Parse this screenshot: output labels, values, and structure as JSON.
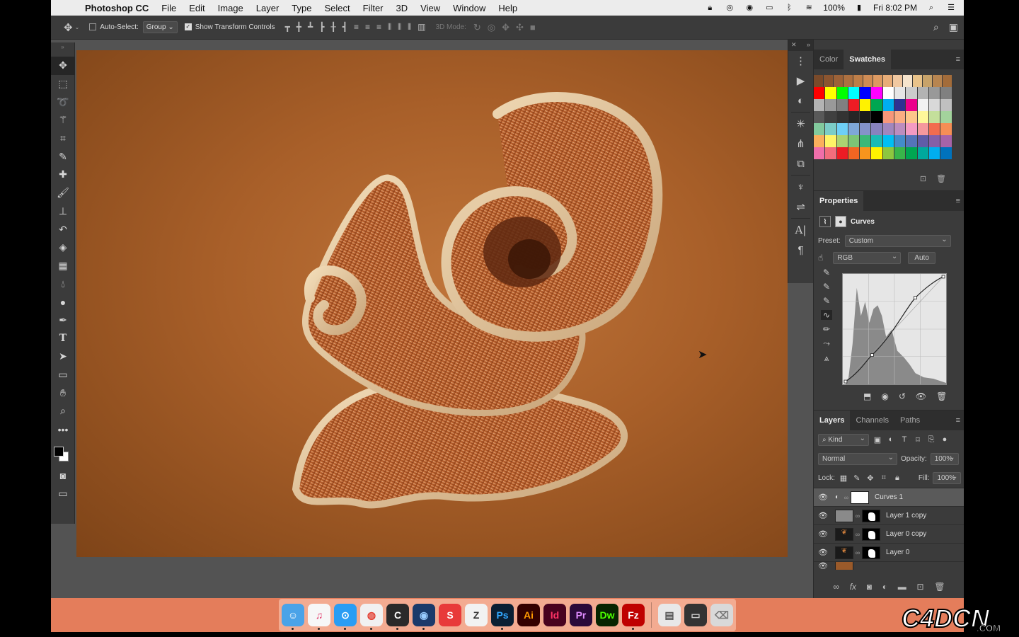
{
  "menubar": {
    "app_name": "Photoshop CC",
    "items": [
      "File",
      "Edit",
      "Image",
      "Layer",
      "Type",
      "Select",
      "Filter",
      "3D",
      "View",
      "Window",
      "Help"
    ],
    "battery": "100%",
    "clock": "Fri 8:02 PM"
  },
  "options": {
    "auto_select_label": "Auto-Select:",
    "auto_select_value": "Group",
    "show_transform_label": "Show Transform Controls",
    "mode_3d_label": "3D Mode:"
  },
  "swatches_panel": {
    "tabs": [
      "Color",
      "Swatches"
    ],
    "active_tab": "Swatches",
    "rows": [
      [
        "#7a4a2a",
        "#8b5530",
        "#9c6238",
        "#ad7040",
        "#be7e48",
        "#cf8c55",
        "#dd9a62",
        "#e8ad78",
        "#f1c8a0",
        "#f6e4cc",
        "#e9c38a",
        "#c8a36a",
        "#b88550",
        "#a36c3a"
      ],
      [
        "#ff0000",
        "#ffff00",
        "#00ff00",
        "#00ffff",
        "#0000ff",
        "#ff00ff",
        "#ffffff",
        "#e6e6e6",
        "#cccccc",
        "#b3b3b3",
        "#999999",
        "#808080"
      ],
      [
        "#b3b3b3",
        "#999999",
        "#808080",
        "#ed1c24",
        "#fff200",
        "#00a651",
        "#00aeef",
        "#2e3192",
        "#ec008c",
        "#f2f2f2",
        "#d9d9d9",
        "#c0c0c0"
      ],
      [
        "#595959",
        "#404040",
        "#333333",
        "#262626",
        "#1a1a1a",
        "#000000",
        "#f7977a",
        "#fbad82",
        "#fdc68a",
        "#fff79a",
        "#c4df9b",
        "#a3d39c"
      ],
      [
        "#82ca9d",
        "#7bcdc8",
        "#6ecff6",
        "#7ea7d8",
        "#8493ca",
        "#8882be",
        "#a187be",
        "#bc8dbf",
        "#f49ac2",
        "#f6989d",
        "#f26c4f",
        "#f68e55"
      ],
      [
        "#fbaf5c",
        "#fff467",
        "#acd372",
        "#7cc576",
        "#3bb878",
        "#1abbb4",
        "#00bff3",
        "#438cca",
        "#5574b9",
        "#605ca8",
        "#855fa8",
        "#a763a8"
      ],
      [
        "#f06eaa",
        "#f26d7d",
        "#ed1c24",
        "#f26522",
        "#f7941d",
        "#fff200",
        "#8dc73f",
        "#39b54a",
        "#00a651",
        "#00a99d",
        "#00aeef",
        "#0072bc"
      ]
    ]
  },
  "properties_panel": {
    "title": "Properties",
    "adjustment": "Curves",
    "preset_label": "Preset:",
    "preset_value": "Custom",
    "channel_value": "RGB",
    "auto_label": "Auto"
  },
  "layers_panel": {
    "tabs": [
      "Layers",
      "Channels",
      "Paths"
    ],
    "active_tab": "Layers",
    "filter_kind": "Kind",
    "blend_mode": "Normal",
    "opacity_label": "Opacity:",
    "opacity_value": "100%",
    "lock_label": "Lock:",
    "fill_label": "Fill:",
    "fill_value": "100%",
    "layers": [
      {
        "name": "Curves 1",
        "selected": true
      },
      {
        "name": "Layer 1 copy",
        "selected": false
      },
      {
        "name": "Layer 0 copy",
        "selected": false
      },
      {
        "name": "Layer 0",
        "selected": false
      }
    ]
  },
  "dock_apps": [
    {
      "label": "☺",
      "bg": "#4aa3e8",
      "fg": "#fff"
    },
    {
      "label": "♫",
      "bg": "#f7f7f7",
      "fg": "#e23a6b"
    },
    {
      "label": "⊙",
      "bg": "#2a9df4",
      "fg": "#fff"
    },
    {
      "label": "◍",
      "bg": "#f1f1f1",
      "fg": "#e33b2e"
    },
    {
      "label": "C",
      "bg": "#2a2a2a",
      "fg": "#fff"
    },
    {
      "label": "◉",
      "bg": "#1a3a6a",
      "fg": "#9cf"
    },
    {
      "label": "S",
      "bg": "#e83a3a",
      "fg": "#fff"
    },
    {
      "label": "Z",
      "bg": "#f2f2f2",
      "fg": "#333"
    },
    {
      "label": "Ps",
      "bg": "#0a1f33",
      "fg": "#31a8ff"
    },
    {
      "label": "Ai",
      "bg": "#330000",
      "fg": "#ff9a00"
    },
    {
      "label": "Id",
      "bg": "#49021f",
      "fg": "#ff3366"
    },
    {
      "label": "Pr",
      "bg": "#2a0a3a",
      "fg": "#e08cff"
    },
    {
      "label": "Dw",
      "bg": "#072401",
      "fg": "#4cff00"
    },
    {
      "label": "Fz",
      "bg": "#bf0000",
      "fg": "#fff"
    },
    {
      "label": "▤",
      "bg": "#e8e8e8",
      "fg": "#555"
    },
    {
      "label": "▭",
      "bg": "#333",
      "fg": "#ccc"
    },
    {
      "label": "⌫",
      "bg": "#d9d9d9",
      "fg": "#777"
    }
  ],
  "watermark_text": "C4DCN"
}
